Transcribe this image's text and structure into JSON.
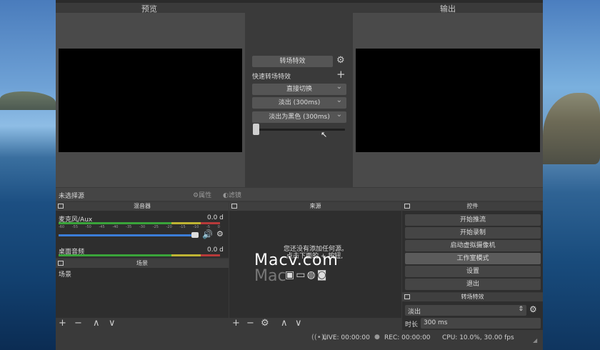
{
  "panes": {
    "preview_label": "预览",
    "output_label": "输出"
  },
  "transition": {
    "header_label": "转场特效",
    "quick_label": "快速转场特效",
    "items": [
      "直接切换",
      "淡出 (300ms)",
      "淡出为黑色 (300ms)"
    ]
  },
  "source_bar": {
    "no_source": "未选择源",
    "properties": "属性",
    "filters": "滤镜"
  },
  "mixer": {
    "title": "混音器",
    "channels": [
      {
        "name": "麦克风/Aux",
        "level": "0.0 d"
      },
      {
        "name": "桌面音频",
        "level": "0.0 d"
      }
    ],
    "ticks": [
      "-60",
      "-55",
      "-50",
      "-45",
      "-40",
      "-35",
      "-30",
      "-25",
      "-20",
      "-15",
      "-10",
      "-5",
      "0"
    ]
  },
  "scenes": {
    "title": "场景",
    "items": [
      "场景"
    ]
  },
  "sources": {
    "title": "来源",
    "empty_line1": "您还没有添加任何源。",
    "empty_line2": "点击下面的 + 按钮,"
  },
  "controls": {
    "title": "控件",
    "buttons": [
      "开始推流",
      "开始录制",
      "启动虚拟摄像机",
      "工作室模式",
      "设置",
      "退出"
    ]
  },
  "transitions_dock": {
    "title": "转场特效",
    "selected": "淡出",
    "duration_label": "时长",
    "duration_value": "300 ms"
  },
  "status": {
    "live": "LIVE: 00:00:00",
    "rec": "REC: 00:00:00",
    "cpu": "CPU: 10.0%, 30.00 fps"
  },
  "watermark": {
    "text": "Macv.com",
    "ghost": "Mac"
  },
  "icons": [
    "gear-icon",
    "plus-icon",
    "minus-icon",
    "up-icon",
    "down-icon",
    "speaker-icon",
    "broadcast-icon"
  ]
}
